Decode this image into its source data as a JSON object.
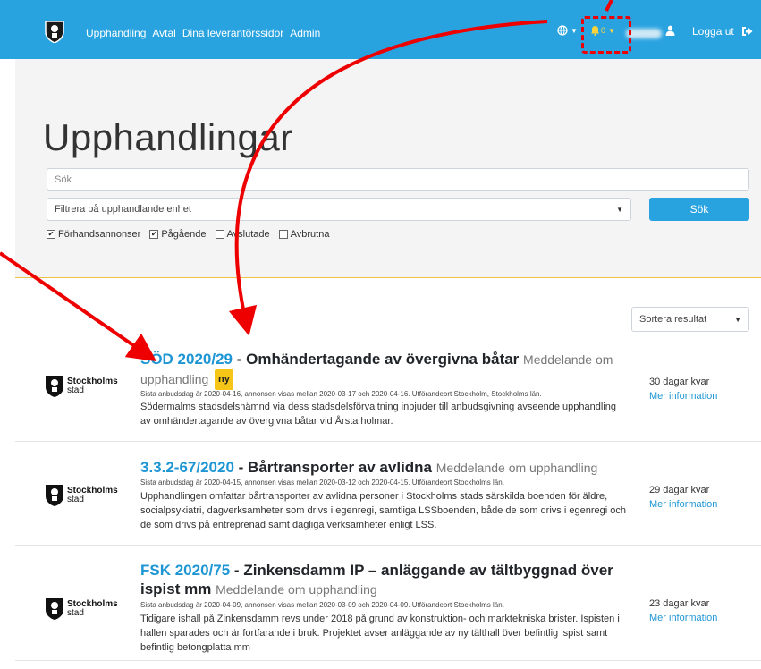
{
  "nav": {
    "links": [
      "Upphandling",
      "Avtal",
      "Dina leverantörssidor",
      "Admin"
    ],
    "bell_count": "0",
    "logout_label": "Logga ut"
  },
  "page": {
    "title": "Upphandlingar",
    "search_placeholder": "Sök",
    "filter_placeholder": "Filtrera på upphandlande enhet",
    "search_button": "Sök",
    "checkboxes": [
      {
        "label": "Förhandsannonser",
        "checked": true
      },
      {
        "label": "Pågående",
        "checked": true
      },
      {
        "label": "Avslutade",
        "checked": false
      },
      {
        "label": "Avbrutna",
        "checked": false
      }
    ],
    "sort_label": "Sortera resultat"
  },
  "org": {
    "line1": "Stockholms",
    "line2": "stad"
  },
  "results": [
    {
      "ref": "SÖD 2020/29",
      "title": "Omhändertagande av övergivna båtar",
      "type": "Meddelande om upphandling",
      "badge": "ny",
      "meta": "Sista anbudsdag är 2020-04-16, annonsen visas mellan 2020-03-17 och 2020-04-16. Utförandeort Stockholm, Stockholms län.",
      "desc": "Södermalms stadsdelsnämnd via dess stadsdelsförvaltning inbjuder till anbudsgivning avseende upphandling av omhändertagande av övergivna båtar vid Årsta holmar.",
      "days": "30 dagar kvar",
      "more": "Mer information"
    },
    {
      "ref": "3.3.2-67/2020",
      "title": "Bårtransporter av avlidna",
      "type": "Meddelande om upphandling",
      "badge": "",
      "meta": "Sista anbudsdag är 2020-04-15, annonsen visas mellan 2020-03-12 och 2020-04-15. Utförandeort Stockholms län.",
      "desc": "Upphandlingen omfattar bårtransporter av avlidna personer i Stockholms stads särskilda boenden för äldre, socialpsykiatri, dagverksamheter som drivs i egenregi, samtliga LSSboenden, både de som drivs i egenregi och de som drivs på entreprenad samt dagliga verksamheter enligt LSS.",
      "days": "29 dagar kvar",
      "more": "Mer information"
    },
    {
      "ref": "FSK 2020/75",
      "title": "Zinkensdamm IP – anläggande av tältbyggnad över ispist mm",
      "type": "Meddelande om upphandling",
      "badge": "",
      "meta": "Sista anbudsdag är 2020-04-09, annonsen visas mellan 2020-03-09 och 2020-04-09. Utförandeort Stockholms län.",
      "desc": "Tidigare ishall på Zinkensdamm revs under 2018 på grund av konstruktion- och marktekniska brister. Ispisten i hallen sparades och är fortfarande i bruk. Projektet avser anläggande av ny tälthall över befintlig ispist samt befintlig betongplatta mm",
      "days": "23 dagar kvar",
      "more": "Mer information"
    }
  ],
  "colors": {
    "brand": "#29a3e0",
    "link": "#1e96d4",
    "badge": "#f5c518",
    "annotation": "#e00000"
  },
  "icons": [
    "crest-icon",
    "globe-icon",
    "bell-icon",
    "user-icon",
    "logout-icon",
    "chevron-down-icon",
    "checkbox-icon"
  ]
}
